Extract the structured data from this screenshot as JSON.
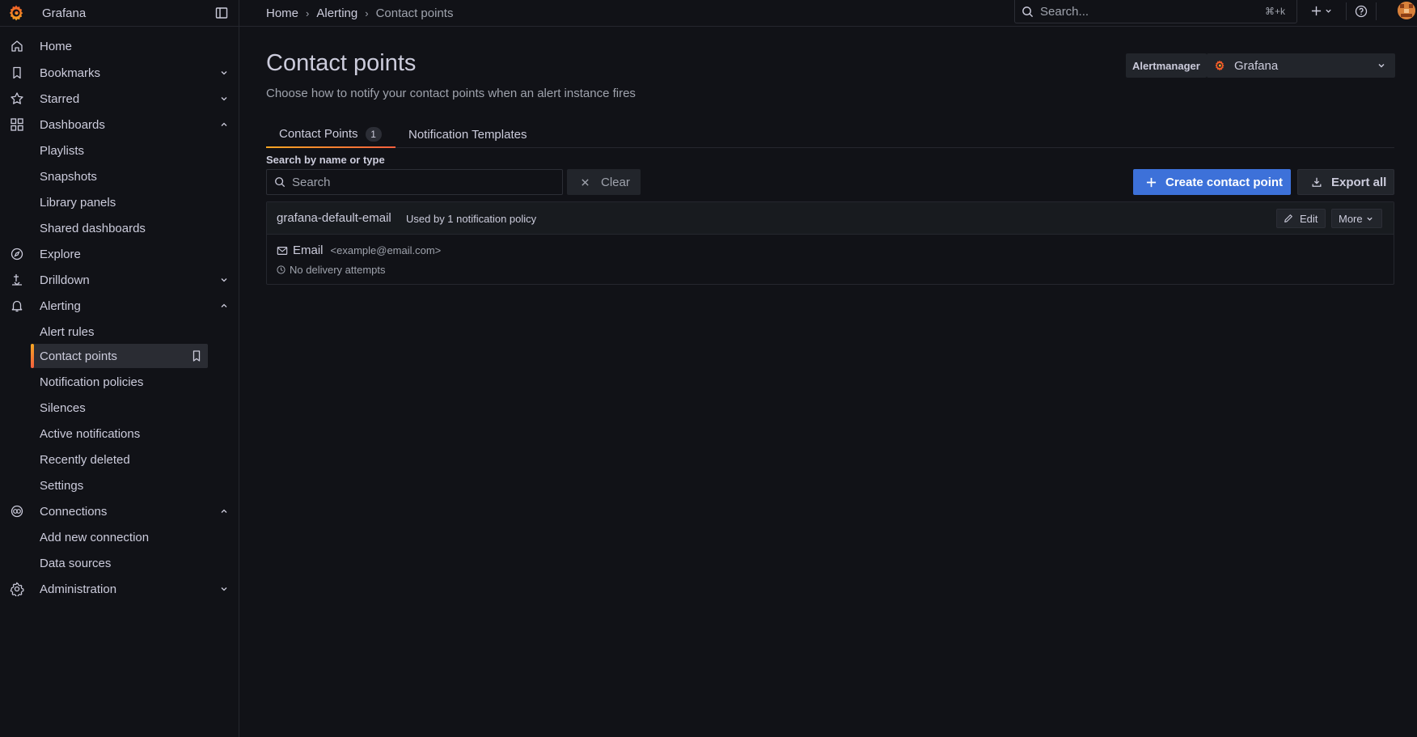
{
  "app": {
    "name": "Grafana"
  },
  "breadcrumb": [
    "Home",
    "Alerting",
    "Contact points"
  ],
  "top_search": {
    "placeholder": "Search...",
    "shortcut": "⌘+k"
  },
  "sidebar": {
    "items": [
      {
        "label": "Home",
        "icon": "home-icon"
      },
      {
        "label": "Bookmarks",
        "icon": "bookmark-icon",
        "chevron": "down"
      },
      {
        "label": "Starred",
        "icon": "star-icon",
        "chevron": "down"
      },
      {
        "label": "Dashboards",
        "icon": "dashboards-icon",
        "chevron": "up"
      },
      {
        "label": "Playlists",
        "sub": true
      },
      {
        "label": "Snapshots",
        "sub": true
      },
      {
        "label": "Library panels",
        "sub": true
      },
      {
        "label": "Shared dashboards",
        "sub": true
      },
      {
        "label": "Explore",
        "icon": "compass-icon"
      },
      {
        "label": "Drilldown",
        "icon": "drilldown-icon",
        "chevron": "down"
      },
      {
        "label": "Alerting",
        "icon": "bell-icon",
        "chevron": "up"
      },
      {
        "label": "Alert rules",
        "sub": true
      },
      {
        "label": "Contact points",
        "sub": true,
        "active": true
      },
      {
        "label": "Notification policies",
        "sub": true
      },
      {
        "label": "Silences",
        "sub": true
      },
      {
        "label": "Active notifications",
        "sub": true
      },
      {
        "label": "Recently deleted",
        "sub": true
      },
      {
        "label": "Settings",
        "sub": true
      },
      {
        "label": "Connections",
        "icon": "connections-icon",
        "chevron": "up"
      },
      {
        "label": "Add new connection",
        "sub": true
      },
      {
        "label": "Data sources",
        "sub": true
      },
      {
        "label": "Administration",
        "icon": "gear-icon",
        "chevron": "down"
      }
    ]
  },
  "page": {
    "title": "Contact points",
    "subtitle": "Choose how to notify your contact points when an alert instance fires"
  },
  "alertmanager": {
    "label": "Alertmanager",
    "value": "Grafana"
  },
  "tabs": [
    {
      "label": "Contact Points",
      "count": "1",
      "active": true
    },
    {
      "label": "Notification Templates"
    }
  ],
  "search": {
    "label": "Search by name or type",
    "placeholder": "Search",
    "clear_label": "Clear"
  },
  "actions": {
    "create_label": "Create contact point",
    "export_label": "Export all"
  },
  "contact_point": {
    "name": "grafana-default-email",
    "usage": "Used by 1 notification policy",
    "edit_label": "Edit",
    "more_label": "More",
    "integration_type": "Email",
    "integration_address": "<example@email.com>",
    "delivery_status": "No delivery attempts"
  },
  "colors": {
    "accent_orange": "#f55f3e",
    "primary_blue": "#3d71d9",
    "background": "#111217"
  }
}
